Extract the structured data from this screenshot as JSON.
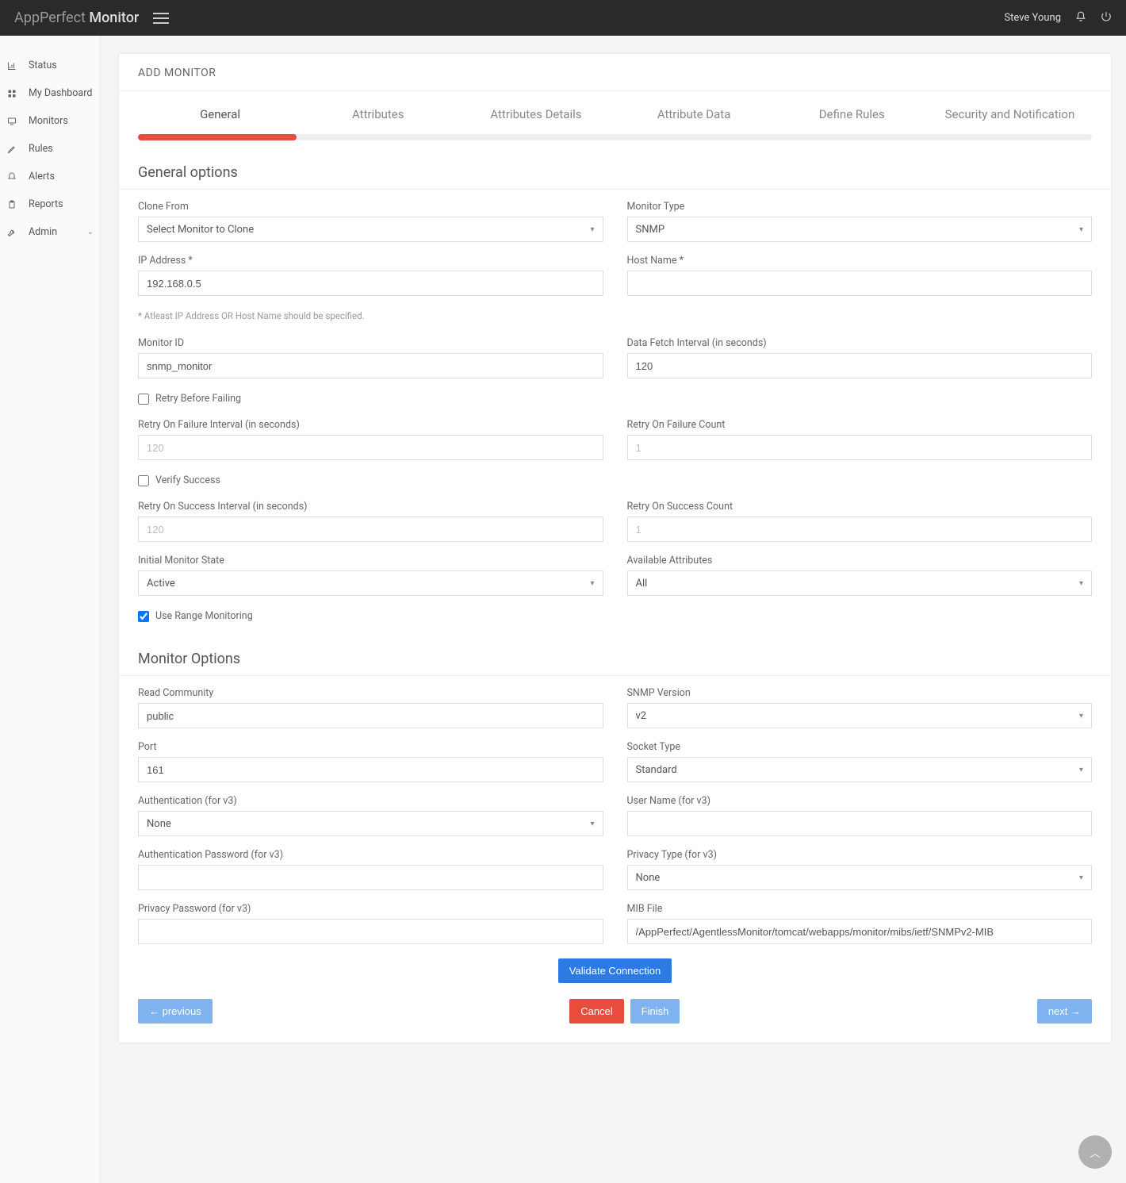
{
  "brand": {
    "prefix": "AppPerfect ",
    "name": "Monitor"
  },
  "user": {
    "name": "Steve Young"
  },
  "sidebar": {
    "items": [
      {
        "label": "Status",
        "icon": "chart"
      },
      {
        "label": "My Dashboard",
        "icon": "grid"
      },
      {
        "label": "Monitors",
        "icon": "monitor"
      },
      {
        "label": "Rules",
        "icon": "pencil"
      },
      {
        "label": "Alerts",
        "icon": "bell"
      },
      {
        "label": "Reports",
        "icon": "clipboard"
      },
      {
        "label": "Admin",
        "icon": "wrench",
        "expandable": true
      }
    ]
  },
  "page_title": "ADD MONITOR",
  "tabs": [
    {
      "label": "General",
      "active": true
    },
    {
      "label": "Attributes",
      "active": false
    },
    {
      "label": "Attributes Details",
      "active": false
    },
    {
      "label": "Attribute Data",
      "active": false
    },
    {
      "label": "Define Rules",
      "active": false
    },
    {
      "label": "Security and Notification",
      "active": false
    }
  ],
  "sections": {
    "general": {
      "title": "General options",
      "clone_from": {
        "label": "Clone From",
        "value": "Select Monitor to Clone"
      },
      "monitor_type": {
        "label": "Monitor Type",
        "value": "SNMP"
      },
      "ip_address": {
        "label": "IP Address *",
        "value": "192.168.0.5"
      },
      "host_name": {
        "label": "Host Name *",
        "value": ""
      },
      "ip_host_note": "* Atleast IP Address OR Host Name should be specified.",
      "monitor_id": {
        "label": "Monitor ID",
        "value": "snmp_monitor"
      },
      "fetch_interval": {
        "label": "Data Fetch Interval (in seconds)",
        "value": "120"
      },
      "retry_before": {
        "label": "Retry Before Failing",
        "checked": false
      },
      "retry_fail_interval": {
        "label": "Retry On Failure Interval (in seconds)",
        "placeholder": "120"
      },
      "retry_fail_count": {
        "label": "Retry On Failure Count",
        "placeholder": "1"
      },
      "verify_success": {
        "label": "Verify Success",
        "checked": false
      },
      "retry_success_interval": {
        "label": "Retry On Success Interval (in seconds)",
        "placeholder": "120"
      },
      "retry_success_count": {
        "label": "Retry On Success Count",
        "placeholder": "1"
      },
      "initial_state": {
        "label": "Initial Monitor State",
        "value": "Active"
      },
      "available_attrs": {
        "label": "Available Attributes",
        "value": "All"
      },
      "use_range": {
        "label": "Use Range Monitoring",
        "checked": true
      }
    },
    "monitor": {
      "title": "Monitor Options",
      "read_community": {
        "label": "Read Community",
        "value": "public"
      },
      "snmp_version": {
        "label": "SNMP Version",
        "value": "v2"
      },
      "port": {
        "label": "Port",
        "value": "161"
      },
      "socket_type": {
        "label": "Socket Type",
        "value": "Standard"
      },
      "auth_v3": {
        "label": "Authentication (for v3)",
        "value": "None"
      },
      "user_v3": {
        "label": "User Name (for v3)",
        "value": ""
      },
      "auth_pw_v3": {
        "label": "Authentication Password (for v3)",
        "value": ""
      },
      "privacy_type": {
        "label": "Privacy Type (for v3)",
        "value": "None"
      },
      "privacy_pw": {
        "label": "Privacy Password (for v3)",
        "value": ""
      },
      "mib_file": {
        "label": "MIB File",
        "value": "/AppPerfect/AgentlessMonitor/tomcat/webapps/monitor/mibs/ietf/SNMPv2-MIB"
      }
    }
  },
  "buttons": {
    "validate": "Validate Connection",
    "previous": "← previous",
    "cancel": "Cancel",
    "finish": "Finish",
    "next": "next →"
  }
}
